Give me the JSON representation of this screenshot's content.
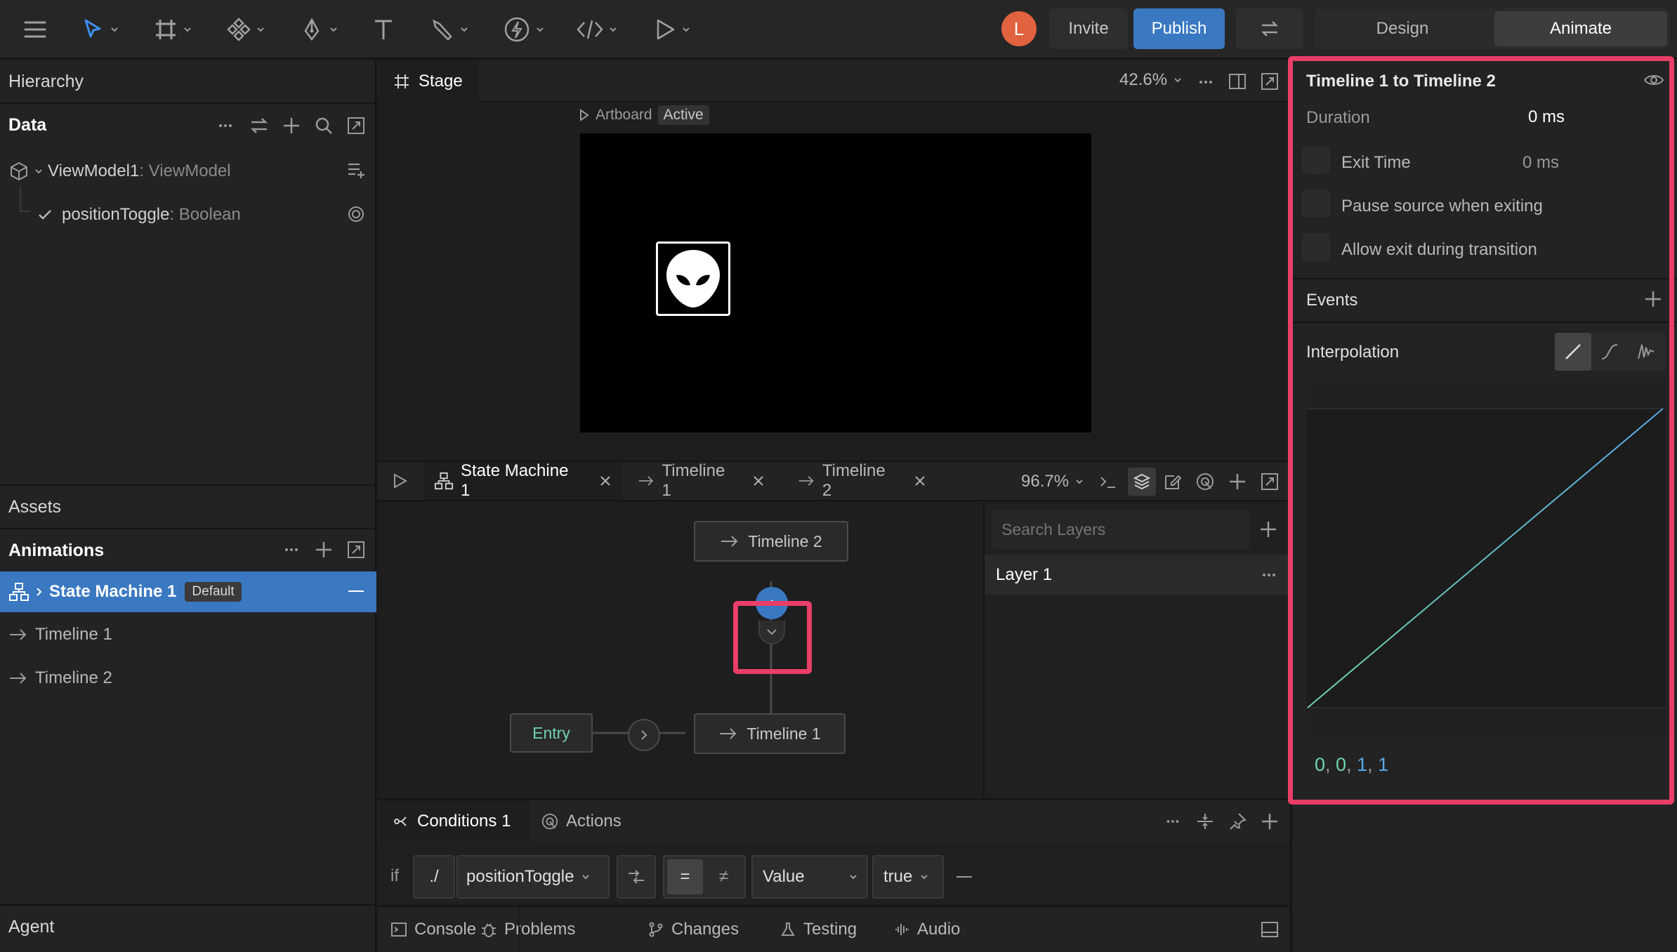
{
  "toolbar": {
    "avatar_letter": "L",
    "invite_label": "Invite",
    "publish_label": "Publish",
    "mode_tabs": [
      "Design",
      "Animate"
    ],
    "active_mode": "Animate"
  },
  "left": {
    "hierarchy_title": "Hierarchy",
    "data_title": "Data",
    "viewmodel_name": "ViewModel1",
    "viewmodel_type": ": ViewModel",
    "property_name": "positionToggle",
    "property_type": ": Boolean",
    "assets_title": "Assets",
    "animations_title": "Animations",
    "animations": [
      {
        "label": "State Machine 1",
        "badge": "Default"
      },
      {
        "label": "Timeline 1"
      },
      {
        "label": "Timeline 2"
      }
    ],
    "agent_title": "Agent"
  },
  "stage": {
    "tab_label": "Stage",
    "zoom": "42.6%",
    "artboard_label": "Artboard",
    "artboard_status": "Active"
  },
  "state_machine": {
    "tabs": [
      "State Machine 1",
      "Timeline 1",
      "Timeline 2"
    ],
    "zoom": "96.7%",
    "nodes": {
      "entry": "Entry",
      "timeline1": "Timeline 1",
      "timeline2": "Timeline 2"
    },
    "search_placeholder": "Search Layers",
    "layer_name": "Layer 1"
  },
  "conditions": {
    "tab_conditions": "Conditions 1",
    "tab_actions": "Actions",
    "if_label": "if",
    "path": "./",
    "property": "positionToggle",
    "op_equal": "=",
    "op_not_equal": "≠",
    "value_type": "Value",
    "value": "true"
  },
  "bottom_tabs": [
    "Console",
    "Problems",
    "Changes",
    "Testing",
    "Audio"
  ],
  "inspector": {
    "title": "Timeline 1 to Timeline 2",
    "duration_label": "Duration",
    "duration_value": "0 ms",
    "exit_time_label": "Exit Time",
    "exit_time_value": "0 ms",
    "pause_label": "Pause source when exiting",
    "allow_exit_label": "Allow exit during transition",
    "events_label": "Events",
    "interpolation_label": "Interpolation",
    "curve_values": [
      "0",
      "0",
      "1",
      "1"
    ]
  },
  "colors": {
    "accent": "#3a78c2",
    "highlight": "#e83e68",
    "avatar": "#e0623f",
    "curve_start": "#6fd3a8",
    "curve_end": "#5aa9e6"
  }
}
